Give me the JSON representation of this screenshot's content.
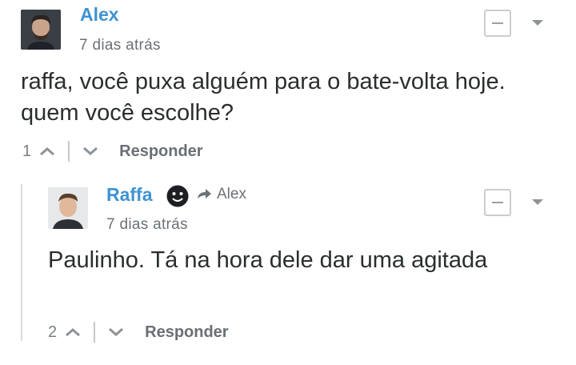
{
  "comments": [
    {
      "author": "Alex",
      "time": "7 dias atrás",
      "text": "raffa, você puxa alguém para o bate-volta hoje. quem você escolhe?",
      "votes": "1",
      "reply_label": "Responder",
      "avatar_icon": "user-avatar-bearded-man"
    }
  ],
  "reply": {
    "author": "Raffa",
    "badge_icon": "dark-smiley-badge-icon",
    "reply_to_icon": "reply-arrow-icon",
    "reply_to": "Alex",
    "time": "7 dias atrás",
    "text": "Paulinho. Tá na hora dele dar uma agitada",
    "votes": "2",
    "reply_label": "Responder",
    "avatar_icon": "user-avatar-young-man"
  },
  "colors": {
    "author": "#3d93d2",
    "text": "#2a2e2e",
    "muted": "#6b7176",
    "divider": "#d7dadd"
  }
}
